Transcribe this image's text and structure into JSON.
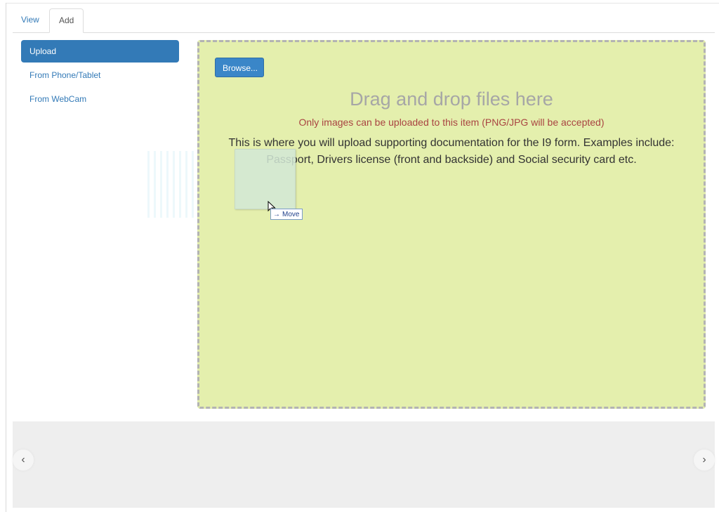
{
  "tabs": [
    {
      "label": "View"
    },
    {
      "label": "Add"
    }
  ],
  "sidenav": {
    "items": [
      {
        "label": "Upload",
        "active": true
      },
      {
        "label": "From Phone/Tablet"
      },
      {
        "label": "From WebCam"
      }
    ]
  },
  "dropzone": {
    "browse_label": "Browse...",
    "title": "Drag and drop files here",
    "warning": "Only images can be uploaded to this item (PNG/JPG will be accepted)",
    "description": "This is where you will upload supporting documentation for the I9 form. Examples include: Passport, Drivers license (front and backside) and Social security card etc."
  },
  "drag_feedback": {
    "label": "Move"
  },
  "carousel": {
    "prev_icon": "chevron-left-icon",
    "next_icon": "chevron-right-icon"
  },
  "colors": {
    "accent": "#337ab7",
    "dropzone_bg": "#e4efad",
    "warning": "#a94442"
  }
}
